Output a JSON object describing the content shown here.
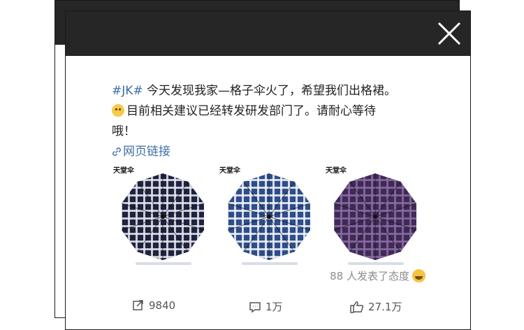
{
  "post": {
    "hashtag": "#JK#",
    "line1": " 今天发现我家—格子伞火了，希望我们出格裙。",
    "line2": "目前相关建议已经转发研发部门了。请耐心等待",
    "line3": "哦！",
    "link_label": "网页链接"
  },
  "images": {
    "brand": "天堂伞",
    "items": [
      {
        "color": "#1e2340",
        "check": "#e8e8ee"
      },
      {
        "color": "#2e4d8a",
        "check": "#f2f4f8"
      },
      {
        "color": "#3d2b52",
        "check": "#8c6aa8"
      }
    ]
  },
  "reaction": {
    "text": "88 人发表了态度"
  },
  "actions": {
    "share_count": "9840",
    "comment_count": "1万",
    "like_count": "27.1万"
  },
  "icons": {
    "close": "close-icon",
    "link": "link-icon",
    "share": "share-icon",
    "comment": "comment-icon",
    "like": "thumbs-up-icon"
  }
}
